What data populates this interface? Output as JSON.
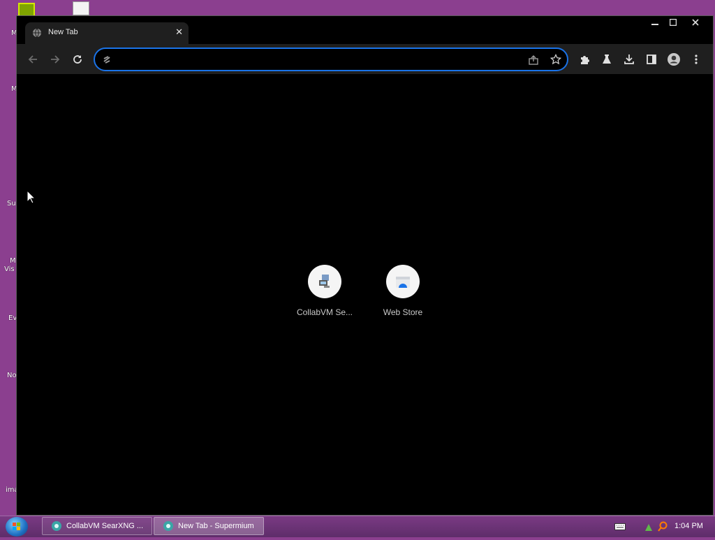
{
  "desktop": {
    "labels": [
      "M",
      "M",
      "Su",
      "M",
      "Vis",
      "Ev",
      "No",
      "ima"
    ]
  },
  "browser": {
    "tab": {
      "title": "New Tab"
    },
    "window_controls": {
      "minimize": "—",
      "maximize": "☐",
      "close": "✕"
    },
    "omnibox": {
      "value": "",
      "placeholder": ""
    },
    "shortcuts": [
      {
        "label": "CollabVM Se...",
        "icon": "collabvm-icon"
      },
      {
        "label": "Web Store",
        "icon": "web-store-icon"
      }
    ]
  },
  "taskbar": {
    "tasks": [
      {
        "label": "CollabVM SearXNG ...",
        "active": false
      },
      {
        "label": "New Tab - Supermium",
        "active": true
      }
    ],
    "clock": "1:04 PM"
  },
  "colors": {
    "desktop": "#8b3f8f",
    "accent": "#1a73e8",
    "toolbar": "#1f1f1f"
  }
}
